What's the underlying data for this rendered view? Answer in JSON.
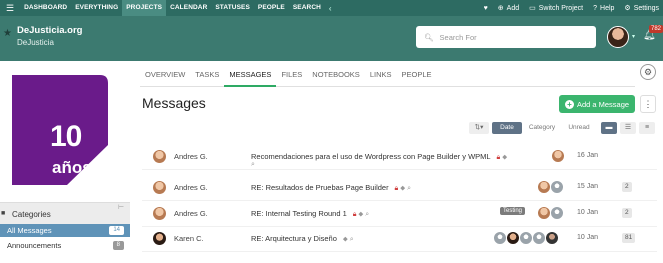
{
  "topnav": {
    "items": [
      {
        "label": "DASHBOARD",
        "active": false
      },
      {
        "label": "EVERYTHING",
        "active": false
      },
      {
        "label": "PROJECTS",
        "active": true
      },
      {
        "label": "CALENDAR",
        "active": false
      },
      {
        "label": "STATUSES",
        "active": false
      },
      {
        "label": "PEOPLE",
        "active": false
      },
      {
        "label": "SEARCH",
        "active": false
      }
    ],
    "add_label": "Add",
    "switch_label": "Switch Project",
    "help_label": "Help",
    "settings_label": "Settings"
  },
  "header": {
    "project_name": "DeJusticia.org",
    "company_name": "DeJusticia",
    "search_placeholder": "Search For",
    "notification_count": "782"
  },
  "sidebar": {
    "logo_number": "10",
    "logo_word": "años",
    "categories_title": "Categories",
    "items": [
      {
        "label": "All Messages",
        "count": "14",
        "active": true
      },
      {
        "label": "Announcements",
        "count": "8",
        "active": false
      }
    ]
  },
  "tabs": [
    {
      "label": "OVERVIEW",
      "active": false
    },
    {
      "label": "TASKS",
      "active": false
    },
    {
      "label": "MESSAGES",
      "active": true
    },
    {
      "label": "FILES",
      "active": false
    },
    {
      "label": "NOTEBOOKS",
      "active": false
    },
    {
      "label": "LINKS",
      "active": false
    },
    {
      "label": "PEOPLE",
      "active": false
    }
  ],
  "main": {
    "title": "Messages",
    "add_button": "Add a Message",
    "sort": {
      "date": "Date",
      "category": "Category",
      "unread": "Unread"
    }
  },
  "messages": [
    {
      "author": "Andres G.",
      "subject": "Recomendaciones para el uso de Wordpress con Page Builder y WPML",
      "date": "16 Jan",
      "count": "",
      "tag": ""
    },
    {
      "author": "Andres G.",
      "subject": "RE: Resultados de Pruebas Page Builder",
      "date": "15 Jan",
      "count": "2",
      "tag": ""
    },
    {
      "author": "Andres G.",
      "subject": "RE: Internal Testing Round 1",
      "date": "10 Jan",
      "count": "2",
      "tag": "Testing"
    },
    {
      "author": "Karen C.",
      "subject": "RE: Arquitectura y Diseño",
      "date": "10 Jan",
      "count": "81",
      "tag": ""
    }
  ],
  "colors": {
    "nav_bg": "#2d6b62",
    "header_bg": "#3c7a70",
    "accent_green": "#3bb56e",
    "logo_purple": "#6a1b8a",
    "active_category": "#5f93b8"
  }
}
